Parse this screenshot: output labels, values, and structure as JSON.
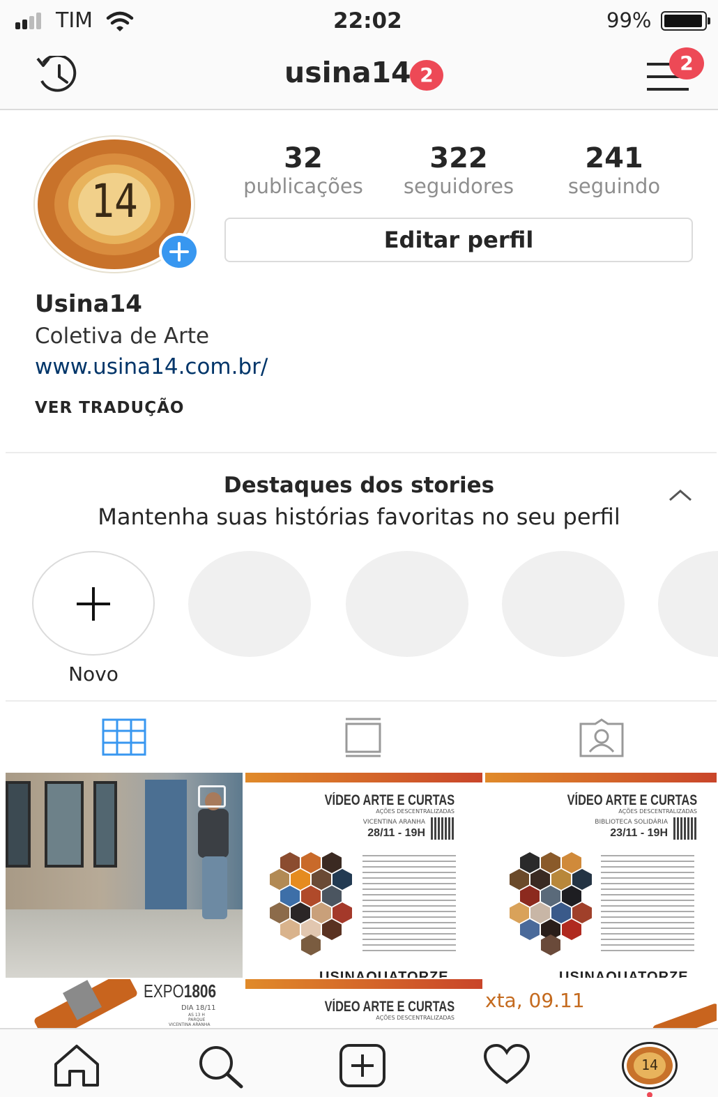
{
  "status_bar": {
    "carrier": "TIM",
    "time": "22:02",
    "battery": "99%"
  },
  "header": {
    "username": "usina14",
    "notification_count": "2",
    "menu_badge": "2"
  },
  "profile": {
    "avatar_text": "14",
    "stats": [
      {
        "value": "32",
        "label": "publicações"
      },
      {
        "value": "322",
        "label": "seguidores"
      },
      {
        "value": "241",
        "label": "seguindo"
      }
    ],
    "edit_button": "Editar perfil",
    "name": "Usina14",
    "bio": "Coletiva de Arte",
    "link": "www.usina14.com.br/",
    "translate": "VER TRADUÇÃO"
  },
  "highlights": {
    "title": "Destaques dos stories",
    "subtitle": "Mantenha suas histórias favoritas no seu perfil",
    "new_label": "Novo"
  },
  "posts": {
    "poster1": {
      "title": "VÍDEO ARTE E CURTAS",
      "sub": "AÇÕES DESCENTRALIZADAS",
      "venue": "VICENTINA ARANHA",
      "date": "28/11 - 19H",
      "brand": "USINAQUATORZE"
    },
    "poster2": {
      "title": "VÍDEO ARTE E CURTAS",
      "sub": "AÇÕES DESCENTRALIZADAS",
      "venue": "BIBLIOTECA SOLIDÁRIA",
      "date": "23/11 - 19H",
      "brand": "USINAQUATORZE"
    },
    "expo": {
      "title_a": "EXPO",
      "title_b": "1806",
      "day": "DIA 18/11",
      "time": "AS 13 H",
      "venue_a": "PARQUE",
      "venue_b": "VICENTINA ARANHA"
    },
    "poster3": {
      "title": "VÍDEO ARTE E CURTAS",
      "sub": "AÇÕES DESCENTRALIZADAS"
    },
    "text_post": "xta, 09.11"
  },
  "colors": {
    "accent_blue": "#3897f0",
    "badge_red": "#ed4956",
    "link_blue": "#003569",
    "avatar_orange": "#c8722a"
  }
}
